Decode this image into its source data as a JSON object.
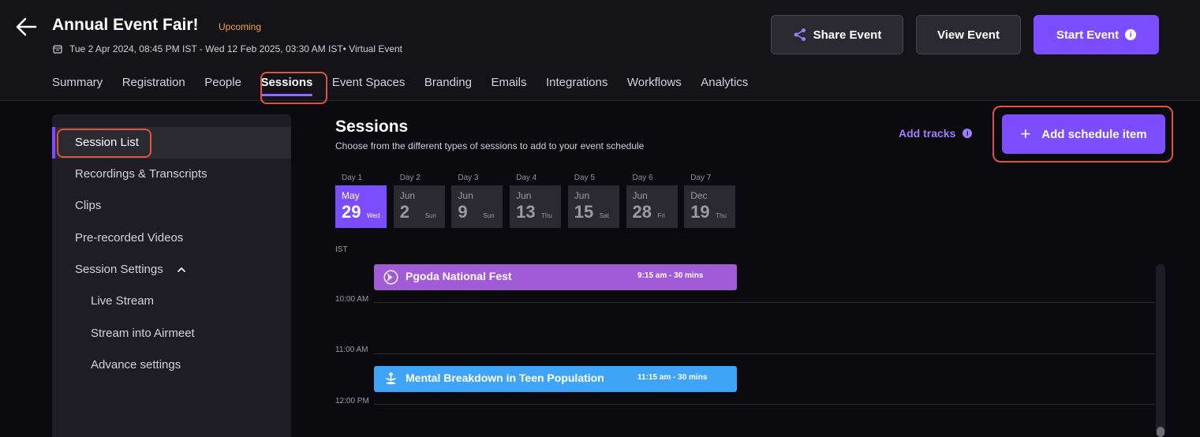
{
  "header": {
    "title": "Annual Event Fair!",
    "status": "Upcoming",
    "dates": "Tue 2 Apr 2024, 08:45 PM IST - Wed 12 Feb 2025, 03:30 AM IST• Virtual Event",
    "buttons": {
      "share": "Share Event",
      "view": "View Event",
      "start": "Start Event"
    }
  },
  "tabs": [
    "Summary",
    "Registration",
    "People",
    "Sessions",
    "Event Spaces",
    "Branding",
    "Emails",
    "Integrations",
    "Workflows",
    "Analytics"
  ],
  "active_tab": "Sessions",
  "sidebar": {
    "items": [
      {
        "label": "Session List"
      },
      {
        "label": "Recordings & Transcripts"
      },
      {
        "label": "Clips"
      },
      {
        "label": "Pre-recorded Videos"
      },
      {
        "label": "Session Settings"
      }
    ],
    "sub_items": [
      {
        "label": "Live Stream"
      },
      {
        "label": "Stream into Airmeet"
      },
      {
        "label": "Advance settings"
      }
    ]
  },
  "main": {
    "title": "Sessions",
    "subtitle": "Choose from the different types of sessions to add to your event schedule",
    "add_tracks": "Add tracks",
    "add_schedule": "Add schedule item",
    "info_glyph": "i",
    "plus_glyph": "+"
  },
  "days": [
    {
      "label": "Day 1",
      "month": "May",
      "day": "29",
      "dow": "Wed"
    },
    {
      "label": "Day 2",
      "month": "Jun",
      "day": "2",
      "dow": "Sun"
    },
    {
      "label": "Day 3",
      "month": "Jun",
      "day": "9",
      "dow": "Sun"
    },
    {
      "label": "Day 4",
      "month": "Jun",
      "day": "13",
      "dow": "Thu"
    },
    {
      "label": "Day 5",
      "month": "Jun",
      "day": "15",
      "dow": "Sat"
    },
    {
      "label": "Day 6",
      "month": "Jun",
      "day": "28",
      "dow": "Fri"
    },
    {
      "label": "Day 7",
      "month": "Dec",
      "day": "19",
      "dow": "Thu"
    }
  ],
  "schedule": {
    "timezone": "IST",
    "times": [
      "10:00 AM",
      "11:00 AM",
      "12:00 PM"
    ],
    "sessions": [
      {
        "title": "Pgoda National Fest",
        "time": "9:15 am - 30 mins",
        "color": "#a25bd6",
        "icon": "broadcast-icon"
      },
      {
        "title": "Mental Breakdown in Teen Population",
        "time": "11:15 am - 30 mins",
        "color": "#3fa3f6",
        "icon": "meditation-icon"
      }
    ]
  },
  "colors": {
    "accent": "#7b4dff",
    "status": "#f59e42",
    "highlight": "#e0543f"
  }
}
